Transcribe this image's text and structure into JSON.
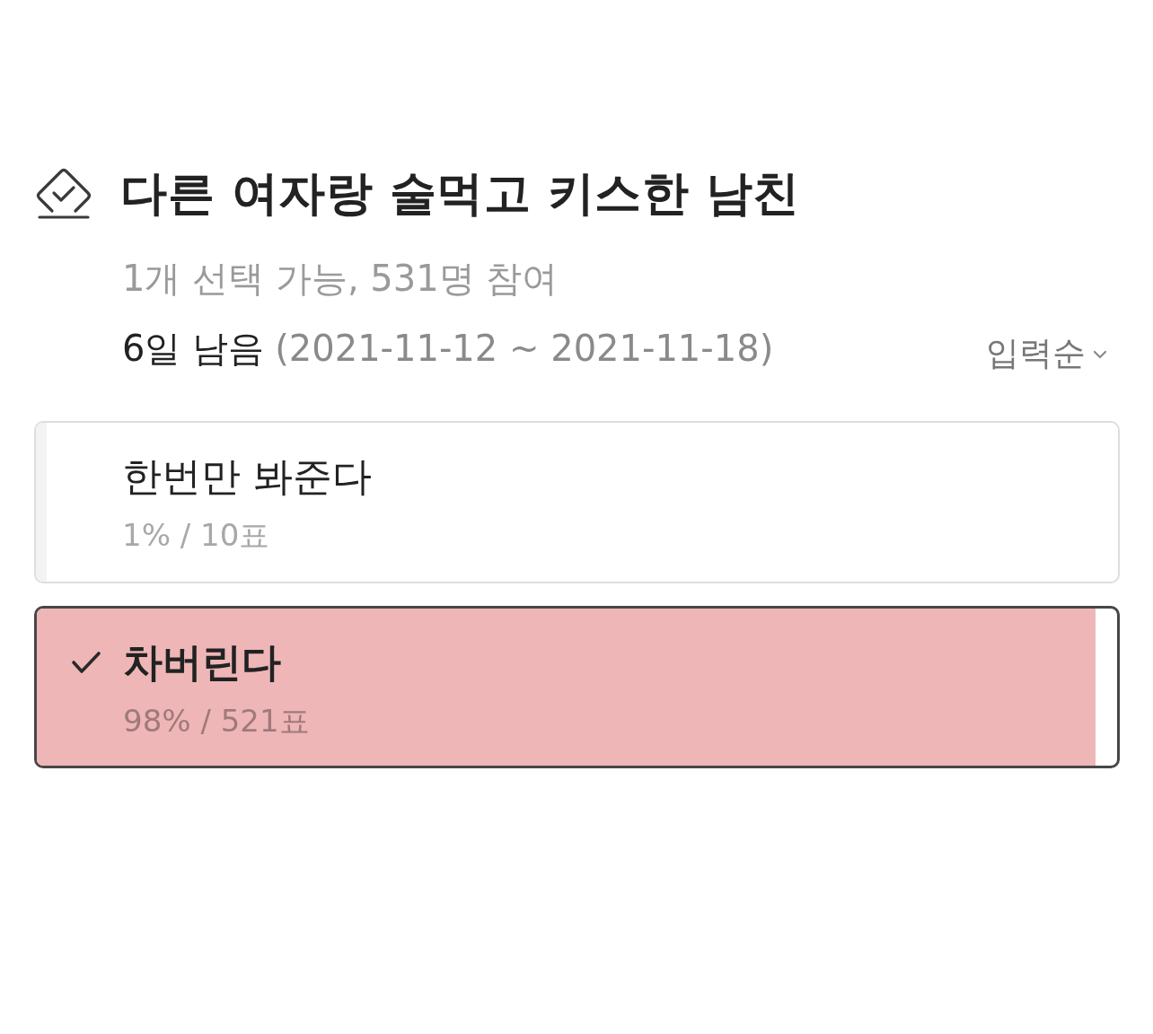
{
  "poll": {
    "title": "다른 여자랑 술먹고 키스한 남친",
    "info": "1개 선택 가능, 531명 참여",
    "remaining": "6일 남음",
    "period": "(2021-11-12 ~ 2021-11-18)",
    "sort": "입력순"
  },
  "options": [
    {
      "label": "한번만 봐준다",
      "result": "1% / 10표",
      "level": 0.01,
      "selected": false
    },
    {
      "label": "차버린다",
      "result": "98% / 521표",
      "level": 0.98,
      "selected": true
    }
  ]
}
